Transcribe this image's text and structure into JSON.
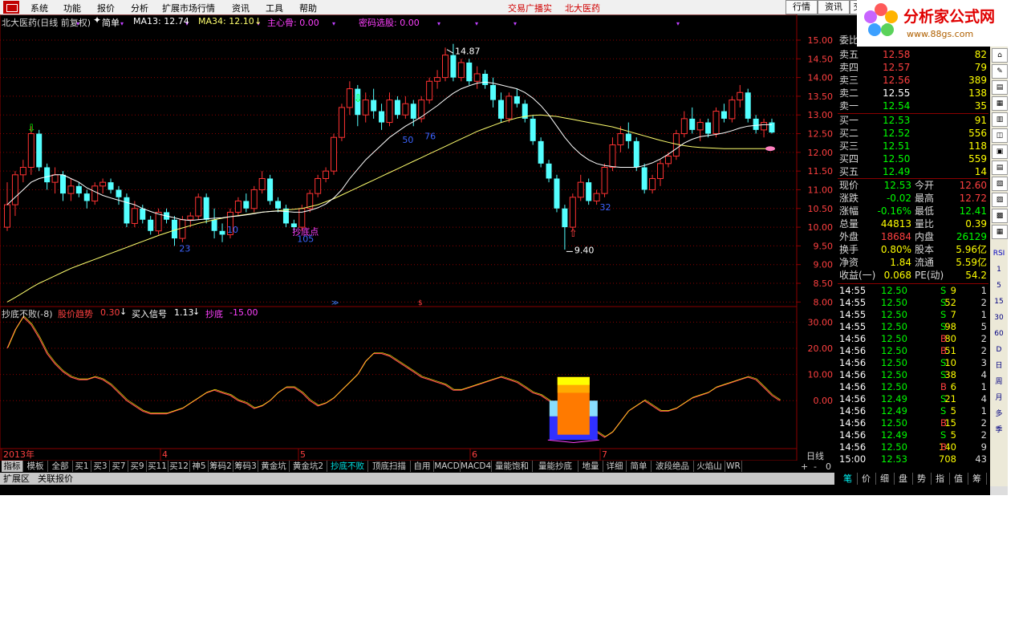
{
  "menu": {
    "items": [
      "系统",
      "功能",
      "报价",
      "分析",
      "扩展市场行情",
      "资讯",
      "工具",
      "帮助"
    ],
    "links": [
      "交易广播实",
      "北大医药"
    ],
    "buttons": [
      "行情",
      "资讯",
      "交"
    ]
  },
  "logo": {
    "title": "分析家公式网",
    "url": "www.88gs.com"
  },
  "main_header": {
    "stock": "北大医药(日线 前复权)",
    "mode": "简单",
    "ma13": "MA13: 12.74",
    "ma34": "MA34: 12.10",
    "arrow": "↓",
    "ind1": "主心骨: 0.00",
    "ind2": "密码选股: 0.00"
  },
  "sub_header": {
    "name": "抄底不败(-8)",
    "item1_label": "股价趋势",
    "item1_value": "0.30",
    "item2_label": "买入信号",
    "item2_value": "1.13",
    "item3_label": "抄底",
    "item3_value": "-15.00"
  },
  "colors": {
    "up": "#ff3232",
    "down": "#54ffff",
    "ma13": "#ffffff",
    "ma34": "#ffff6e",
    "grid": "#8b0000"
  },
  "price_axis": [
    "15.00",
    "14.50",
    "14.00",
    "13.50",
    "13.00",
    "12.50",
    "12.00",
    "11.50",
    "11.00",
    "10.50",
    "10.00",
    "9.50",
    "9.00",
    "8.50",
    "8.00"
  ],
  "osc_axis": [
    "30.00",
    "20.00",
    "10.00",
    "0.00"
  ],
  "time_axis": [
    "2013年",
    "4",
    "5",
    "6",
    "7"
  ],
  "period": "日线",
  "annotations": {
    "high": "14.87",
    "low": "9.40",
    "buy_label": "抄底点",
    "n1": "23",
    "n2": "10",
    "n3": "105",
    "n4": "50",
    "n5": "76",
    "n6": "32"
  },
  "tabs": [
    "指标",
    "模板",
    "全部",
    "买1",
    "买3",
    "买7",
    "买9",
    "买11",
    "买12",
    "神5",
    "筹码2",
    "筹码3",
    "黄金坑",
    "黄金坑2",
    "抄底不败",
    "顶底扫描",
    "自用",
    "MACD",
    "MACD4",
    "量能饱和",
    "量能抄底",
    "地量",
    "详细",
    "简单",
    "波段绝品",
    "火焰山",
    "WR"
  ],
  "tab_controls": [
    "+",
    "-",
    "0"
  ],
  "bottom_tabs": [
    "扩展区",
    "关联报价"
  ],
  "quote": {
    "ratio_label": "委比",
    "asks": [
      {
        "label": "卖五",
        "price": "12.58",
        "vol": "82"
      },
      {
        "label": "卖四",
        "price": "12.57",
        "vol": "79"
      },
      {
        "label": "卖三",
        "price": "12.56",
        "vol": "389"
      },
      {
        "label": "卖二",
        "price": "12.55",
        "vol": "138"
      },
      {
        "label": "卖一",
        "price": "12.54",
        "vol": "35"
      }
    ],
    "bids": [
      {
        "label": "买一",
        "price": "12.53",
        "vol": "91"
      },
      {
        "label": "买二",
        "price": "12.52",
        "vol": "556"
      },
      {
        "label": "买三",
        "price": "12.51",
        "vol": "118"
      },
      {
        "label": "买四",
        "price": "12.50",
        "vol": "559"
      },
      {
        "label": "买五",
        "price": "12.49",
        "vol": "14"
      }
    ],
    "stats": [
      {
        "l1": "现价",
        "v1": "12.53",
        "l2": "今开",
        "v2": "12.60"
      },
      {
        "l1": "涨跌",
        "v1": "-0.02",
        "l2": "最高",
        "v2": "12.72"
      },
      {
        "l1": "涨幅",
        "v1": "-0.16%",
        "l2": "最低",
        "v2": "12.41"
      },
      {
        "l1": "总量",
        "v1": "44813",
        "l2": "量比",
        "v2": "0.39"
      },
      {
        "l1": "外盘",
        "v1": "18684",
        "l2": "内盘",
        "v2": "26129"
      },
      {
        "l1": "换手",
        "v1": "0.80%",
        "l2": "股本",
        "v2": "5.96亿"
      },
      {
        "l1": "净资",
        "v1": "1.84",
        "l2": "流通",
        "v2": "5.59亿"
      },
      {
        "l1": "收益(一)",
        "v1": "0.068",
        "l2": "PE(动)",
        "v2": "54.2"
      }
    ],
    "ticks": [
      {
        "t": "14:55",
        "p": "12.50",
        "v": "9",
        "s": "S",
        "n": "1"
      },
      {
        "t": "14:55",
        "p": "12.50",
        "v": "52",
        "s": "S",
        "n": "2"
      },
      {
        "t": "14:55",
        "p": "12.50",
        "v": "7",
        "s": "S",
        "n": "1"
      },
      {
        "t": "14:55",
        "p": "12.50",
        "v": "98",
        "s": "S",
        "n": "5"
      },
      {
        "t": "14:56",
        "p": "12.50",
        "v": "80",
        "s": "B",
        "n": "2"
      },
      {
        "t": "14:56",
        "p": "12.50",
        "v": "51",
        "s": "B",
        "n": "2"
      },
      {
        "t": "14:56",
        "p": "12.50",
        "v": "10",
        "s": "S",
        "n": "3"
      },
      {
        "t": "14:56",
        "p": "12.50",
        "v": "38",
        "s": "S",
        "n": "4"
      },
      {
        "t": "14:56",
        "p": "12.50",
        "v": "6",
        "s": "B",
        "n": "1"
      },
      {
        "t": "14:56",
        "p": "12.49",
        "v": "21",
        "s": "S",
        "n": "4"
      },
      {
        "t": "14:56",
        "p": "12.49",
        "v": "5",
        "s": "S",
        "n": "1"
      },
      {
        "t": "14:56",
        "p": "12.50",
        "v": "15",
        "s": "B",
        "n": "2"
      },
      {
        "t": "14:56",
        "p": "12.49",
        "v": "5",
        "s": "S",
        "n": "2"
      },
      {
        "t": "14:56",
        "p": "12.50",
        "v": "140",
        "s": "B",
        "n": "9"
      },
      {
        "t": "15:00",
        "p": "12.53",
        "v": "708",
        "s": "",
        "n": "43"
      }
    ],
    "tabs": [
      "笔",
      "价",
      "细",
      "盘",
      "势",
      "指",
      "值",
      "筹"
    ]
  },
  "toolbar": [
    "RSI",
    "1",
    "5",
    "15",
    "30",
    "60",
    "D",
    "日",
    "周",
    "月",
    "多",
    "季"
  ],
  "chart_data": {
    "type": "candlestick",
    "price_ylim": [
      7.9,
      15.3
    ],
    "candles": [
      [
        10.0,
        11.2,
        9.9,
        10.6
      ],
      [
        10.6,
        11.5,
        10.3,
        11.4
      ],
      [
        11.4,
        11.8,
        11.2,
        11.6
      ],
      [
        11.6,
        12.7,
        11.4,
        12.5
      ],
      [
        12.5,
        12.6,
        11.5,
        11.6
      ],
      [
        11.6,
        11.7,
        11.0,
        11.2
      ],
      [
        11.2,
        11.6,
        10.9,
        11.4
      ],
      [
        11.4,
        11.5,
        10.7,
        10.9
      ],
      [
        10.9,
        11.3,
        10.7,
        11.1
      ],
      [
        11.1,
        11.2,
        10.8,
        10.9
      ],
      [
        10.9,
        11.0,
        10.5,
        10.7
      ],
      [
        10.7,
        11.2,
        10.6,
        11.1
      ],
      [
        11.1,
        11.3,
        10.9,
        11.2
      ],
      [
        11.2,
        11.3,
        10.9,
        11.0
      ],
      [
        11.0,
        11.1,
        10.6,
        10.8
      ],
      [
        10.8,
        10.9,
        10.0,
        10.1
      ],
      [
        10.1,
        10.7,
        10.0,
        10.5
      ],
      [
        10.5,
        10.6,
        10.1,
        10.2
      ],
      [
        10.2,
        10.3,
        9.8,
        9.9
      ],
      [
        9.9,
        10.5,
        9.8,
        10.4
      ],
      [
        10.4,
        10.5,
        10.1,
        10.2
      ],
      [
        10.2,
        10.3,
        9.5,
        9.7
      ],
      [
        9.7,
        10.3,
        9.6,
        10.2
      ],
      [
        10.2,
        10.4,
        10.0,
        10.3
      ],
      [
        10.3,
        10.9,
        10.2,
        10.8
      ],
      [
        10.8,
        10.9,
        10.1,
        10.2
      ],
      [
        10.2,
        10.5,
        9.7,
        9.9
      ],
      [
        9.9,
        10.1,
        9.6,
        9.8
      ],
      [
        9.8,
        10.5,
        9.7,
        10.4
      ],
      [
        10.4,
        10.8,
        10.3,
        10.7
      ],
      [
        10.7,
        10.9,
        10.4,
        10.5
      ],
      [
        10.5,
        11.1,
        10.4,
        11.0
      ],
      [
        11.0,
        11.5,
        10.9,
        11.3
      ],
      [
        11.3,
        11.4,
        10.6,
        10.7
      ],
      [
        10.7,
        10.8,
        10.4,
        10.5
      ],
      [
        10.5,
        10.6,
        10.0,
        10.1
      ],
      [
        10.1,
        10.2,
        9.9,
        10.0
      ],
      [
        10.0,
        10.6,
        9.9,
        10.5
      ],
      [
        10.5,
        11.0,
        10.4,
        10.9
      ],
      [
        10.9,
        11.4,
        10.8,
        11.3
      ],
      [
        11.3,
        11.6,
        11.2,
        11.5
      ],
      [
        11.5,
        12.5,
        11.4,
        12.4
      ],
      [
        12.4,
        13.3,
        12.3,
        13.2
      ],
      [
        13.2,
        13.9,
        13.0,
        13.7
      ],
      [
        13.7,
        13.8,
        12.7,
        13.0
      ],
      [
        13.0,
        13.6,
        12.8,
        13.4
      ],
      [
        13.4,
        13.7,
        12.9,
        13.1
      ],
      [
        13.1,
        13.3,
        12.6,
        12.8
      ],
      [
        12.8,
        13.6,
        12.7,
        13.4
      ],
      [
        13.4,
        13.5,
        12.9,
        13.0
      ],
      [
        13.0,
        13.5,
        12.9,
        13.3
      ],
      [
        13.3,
        13.4,
        12.7,
        12.9
      ],
      [
        12.9,
        13.5,
        12.8,
        13.4
      ],
      [
        13.4,
        14.0,
        13.3,
        13.9
      ],
      [
        13.9,
        14.2,
        13.7,
        14.0
      ],
      [
        14.0,
        14.8,
        13.9,
        14.6
      ],
      [
        14.6,
        14.9,
        13.9,
        14.0
      ],
      [
        14.0,
        14.5,
        13.9,
        14.4
      ],
      [
        14.4,
        14.5,
        13.8,
        13.9
      ],
      [
        13.9,
        14.3,
        13.7,
        14.1
      ],
      [
        14.1,
        14.2,
        13.7,
        13.8
      ],
      [
        13.8,
        14.0,
        13.2,
        13.4
      ],
      [
        13.4,
        13.6,
        12.8,
        12.9
      ],
      [
        12.9,
        13.6,
        12.8,
        13.5
      ],
      [
        13.5,
        13.7,
        13.2,
        13.3
      ],
      [
        13.3,
        13.4,
        12.8,
        12.9
      ],
      [
        12.9,
        13.0,
        12.2,
        12.3
      ],
      [
        12.3,
        12.4,
        11.6,
        11.7
      ],
      [
        11.7,
        11.8,
        11.2,
        11.3
      ],
      [
        11.3,
        11.4,
        10.4,
        10.5
      ],
      [
        10.5,
        10.6,
        9.4,
        10.0
      ],
      [
        10.0,
        10.9,
        9.9,
        10.8
      ],
      [
        10.8,
        11.4,
        10.7,
        11.2
      ],
      [
        11.2,
        11.3,
        10.6,
        10.7
      ],
      [
        10.7,
        11.0,
        10.6,
        10.9
      ],
      [
        10.9,
        11.7,
        10.8,
        11.6
      ],
      [
        11.6,
        12.4,
        11.5,
        12.2
      ],
      [
        12.2,
        12.7,
        12.0,
        12.5
      ],
      [
        12.5,
        12.8,
        12.1,
        12.3
      ],
      [
        12.3,
        12.4,
        11.5,
        11.6
      ],
      [
        11.6,
        11.7,
        10.9,
        11.0
      ],
      [
        11.0,
        11.4,
        10.9,
        11.3
      ],
      [
        11.3,
        11.8,
        11.1,
        11.7
      ],
      [
        11.7,
        12.0,
        11.6,
        11.9
      ],
      [
        11.9,
        12.6,
        11.8,
        12.5
      ],
      [
        12.5,
        13.1,
        12.4,
        12.9
      ],
      [
        12.9,
        13.2,
        12.5,
        12.6
      ],
      [
        12.6,
        12.9,
        12.3,
        12.8
      ],
      [
        12.8,
        12.9,
        12.4,
        12.5
      ],
      [
        12.5,
        13.2,
        12.4,
        13.1
      ],
      [
        13.1,
        13.3,
        12.8,
        12.9
      ],
      [
        12.9,
        13.5,
        12.8,
        13.4
      ],
      [
        13.4,
        13.8,
        13.2,
        13.6
      ],
      [
        13.6,
        13.7,
        12.8,
        12.9
      ],
      [
        12.9,
        13.0,
        12.5,
        12.6
      ],
      [
        12.6,
        12.9,
        12.4,
        12.8
      ],
      [
        12.8,
        12.9,
        12.5,
        12.53
      ]
    ],
    "ma13": [
      10.6,
      10.8,
      11.0,
      11.2,
      11.3,
      11.35,
      11.4,
      11.4,
      11.3,
      11.2,
      11.05,
      10.95,
      10.85,
      10.78,
      10.72,
      10.66,
      10.6,
      10.5,
      10.42,
      10.35,
      10.3,
      10.25,
      10.2,
      10.18,
      10.2,
      10.22,
      10.24,
      10.25,
      10.28,
      10.3,
      10.33,
      10.36,
      10.4,
      10.42,
      10.43,
      10.42,
      10.4,
      10.4,
      10.45,
      10.52,
      10.62,
      10.78,
      11.0,
      11.3,
      11.55,
      11.8,
      12.0,
      12.2,
      12.4,
      12.55,
      12.7,
      12.82,
      12.95,
      13.1,
      13.25,
      13.42,
      13.58,
      13.7,
      13.78,
      13.85,
      13.88,
      13.85,
      13.8,
      13.75,
      13.7,
      13.6,
      13.45,
      13.25,
      13.0,
      12.7,
      12.4,
      12.15,
      11.95,
      11.8,
      11.7,
      11.65,
      11.62,
      11.6,
      11.6,
      11.6,
      11.65,
      11.72,
      11.82,
      11.95,
      12.1,
      12.25,
      12.35,
      12.42,
      12.45,
      12.48,
      12.52,
      12.58,
      12.65,
      12.7,
      12.72,
      12.74,
      12.74
    ],
    "ma34": [
      8.0,
      8.12,
      8.25,
      8.38,
      8.5,
      8.6,
      8.7,
      8.8,
      8.9,
      8.98,
      9.06,
      9.14,
      9.22,
      9.3,
      9.38,
      9.46,
      9.54,
      9.62,
      9.7,
      9.78,
      9.85,
      9.92,
      9.98,
      10.04,
      10.1,
      10.15,
      10.2,
      10.24,
      10.28,
      10.31,
      10.34,
      10.37,
      10.4,
      10.42,
      10.44,
      10.46,
      10.48,
      10.5,
      10.55,
      10.6,
      10.68,
      10.76,
      10.86,
      10.96,
      11.06,
      11.16,
      11.26,
      11.36,
      11.46,
      11.56,
      11.66,
      11.76,
      11.86,
      11.96,
      12.06,
      12.16,
      12.26,
      12.36,
      12.46,
      12.56,
      12.64,
      12.72,
      12.8,
      12.86,
      12.92,
      12.96,
      12.99,
      13.0,
      12.98,
      12.96,
      12.92,
      12.88,
      12.84,
      12.8,
      12.76,
      12.72,
      12.68,
      12.62,
      12.56,
      12.5,
      12.44,
      12.38,
      12.32,
      12.27,
      12.22,
      12.18,
      12.15,
      12.13,
      12.12,
      12.11,
      12.1,
      12.1,
      12.1,
      12.1,
      12.1,
      12.1,
      12.1
    ],
    "osc": [
      20,
      27,
      32,
      29,
      24,
      18,
      14,
      11,
      9,
      8,
      8,
      9,
      8,
      6,
      3,
      0,
      -2,
      -4,
      -5,
      -5,
      -5,
      -4,
      -3,
      -1,
      1,
      3,
      4,
      3,
      2,
      0,
      -1,
      -3,
      -2,
      0,
      3,
      5,
      5,
      3,
      0,
      -2,
      -1,
      1,
      4,
      7,
      10,
      15,
      18,
      18,
      17,
      15,
      13,
      11,
      9,
      8,
      7,
      6,
      4,
      4,
      5,
      6,
      7,
      8,
      9,
      8,
      7,
      5,
      3,
      2,
      0,
      -2,
      -4,
      -6,
      -8,
      -10,
      -12,
      -14,
      -12,
      -8,
      -4,
      -2,
      0,
      -2,
      -4,
      -4,
      -3,
      -1,
      1,
      2,
      3,
      5,
      6,
      7,
      8,
      9,
      8,
      5,
      2,
      0
    ],
    "osc_ylim": [
      -18,
      35
    ]
  }
}
